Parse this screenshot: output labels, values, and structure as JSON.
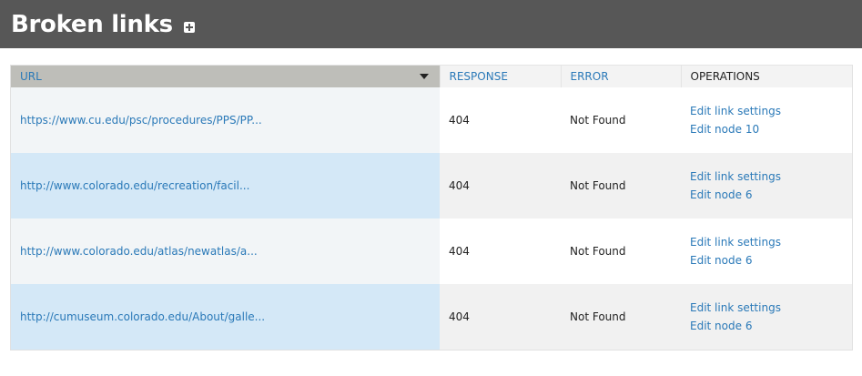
{
  "page": {
    "title": "Broken links",
    "add_icon": "plus-square-icon"
  },
  "table": {
    "columns": {
      "url": "URL",
      "response": "RESPONSE",
      "error": "ERROR",
      "operations": "OPERATIONS"
    },
    "sort_icon": "caret-down-icon",
    "rows": [
      {
        "url": "https://www.cu.edu/psc/procedures/PPS/PP...",
        "response": "404",
        "error": "Not Found",
        "op1": "Edit link settings",
        "op2": "Edit node 10"
      },
      {
        "url": "http://www.colorado.edu/recreation/facil...",
        "response": "404",
        "error": "Not Found",
        "op1": "Edit link settings",
        "op2": "Edit node 6"
      },
      {
        "url": "http://www.colorado.edu/atlas/newatlas/a...",
        "response": "404",
        "error": "Not Found",
        "op1": "Edit link settings",
        "op2": "Edit node 6"
      },
      {
        "url": "http://cumuseum.colorado.edu/About/galle...",
        "response": "404",
        "error": "Not Found",
        "op1": "Edit link settings",
        "op2": "Edit node 6"
      }
    ]
  },
  "colors": {
    "header_bg": "#575757",
    "link": "#2a79b8",
    "sorted_header": "#bebeb9",
    "sorted_cell_highlight": "#d4e8f7"
  }
}
